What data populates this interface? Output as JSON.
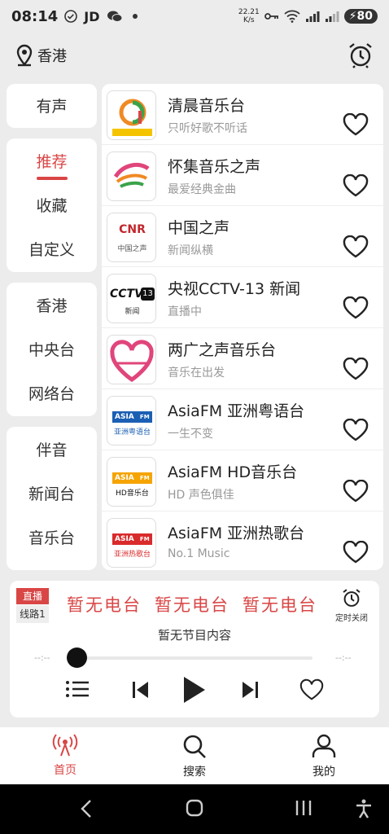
{
  "status_bar": {
    "time": "08:14",
    "app_label": "JD",
    "net_speed_value": "22.21",
    "net_speed_unit": "K/s",
    "battery": "80"
  },
  "header": {
    "location": "香港",
    "icons": [
      "location-pin-icon",
      "alarm-clock-icon"
    ]
  },
  "categories": {
    "group1": [
      {
        "label": "有声"
      }
    ],
    "group2": [
      {
        "label": "推荐",
        "active": true
      },
      {
        "label": "收藏"
      },
      {
        "label": "自定义"
      }
    ],
    "group3": [
      {
        "label": "香港"
      },
      {
        "label": "中央台"
      },
      {
        "label": "网络台"
      }
    ],
    "group4": [
      {
        "label": "伴音"
      },
      {
        "label": "新闻台"
      },
      {
        "label": "音乐台"
      }
    ]
  },
  "logo_texts": {
    "cnr_title": "CNR",
    "cnr_sub": "中国之声",
    "cctv_title": "CCTV",
    "cctv_num": "13",
    "cctv_sub": "新闻",
    "asia_brand": "ASIA",
    "asia_fm": "FM",
    "asia_sub_1": "亚洲粤语台",
    "asia_sub_2": "HD音乐台",
    "asia_sub_3": "亚洲热歌台"
  },
  "stations": [
    {
      "name": "清晨音乐台",
      "desc": "只听好歌不听话"
    },
    {
      "name": "怀集音乐之声",
      "desc": "最爱经典金曲"
    },
    {
      "name": "中国之声",
      "desc": "新闻纵横"
    },
    {
      "name": "央视CCTV-13 新闻",
      "desc": "直播中"
    },
    {
      "name": "两广之声音乐台",
      "desc": "音乐在出发"
    },
    {
      "name": "AsiaFM 亚洲粤语台",
      "desc": "一生不变"
    },
    {
      "name": "AsiaFM HD音乐台",
      "desc": "HD 声色俱佳"
    },
    {
      "name": "AsiaFM 亚洲热歌台",
      "desc": "No.1 Music"
    }
  ],
  "player": {
    "live_badge": "直播",
    "line_badge": "线路1",
    "marquee": [
      "暂无电台",
      "暂无电台",
      "暂无电台"
    ],
    "timer_label": "定时关闭",
    "program": "暂无节目内容",
    "time_elapsed": "--:--",
    "time_total": "--:--",
    "progress": 0
  },
  "bottom_nav": [
    {
      "label": "首页",
      "active": true
    },
    {
      "label": "搜索"
    },
    {
      "label": "我的"
    }
  ],
  "colors": {
    "accent": "#d94646",
    "background": "#ececec"
  }
}
